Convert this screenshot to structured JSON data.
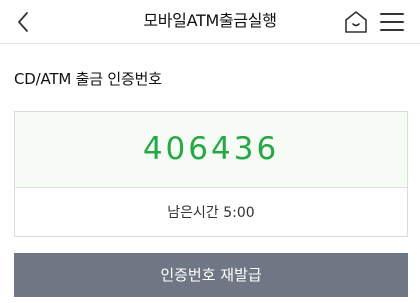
{
  "header": {
    "title": "모바일ATM출금실행",
    "back_icon": "back-arrow-icon",
    "home_icon": "home-icon",
    "menu_icon": "hamburger-menu-icon"
  },
  "section": {
    "title": "CD/ATM 출금 인증번호"
  },
  "auth": {
    "code": "406436",
    "timer_label": "남은시간 5:00"
  },
  "actions": {
    "reissue_label": "인증번호 재발급"
  },
  "colors": {
    "code_color": "#27a844",
    "button_bg": "#707784"
  }
}
